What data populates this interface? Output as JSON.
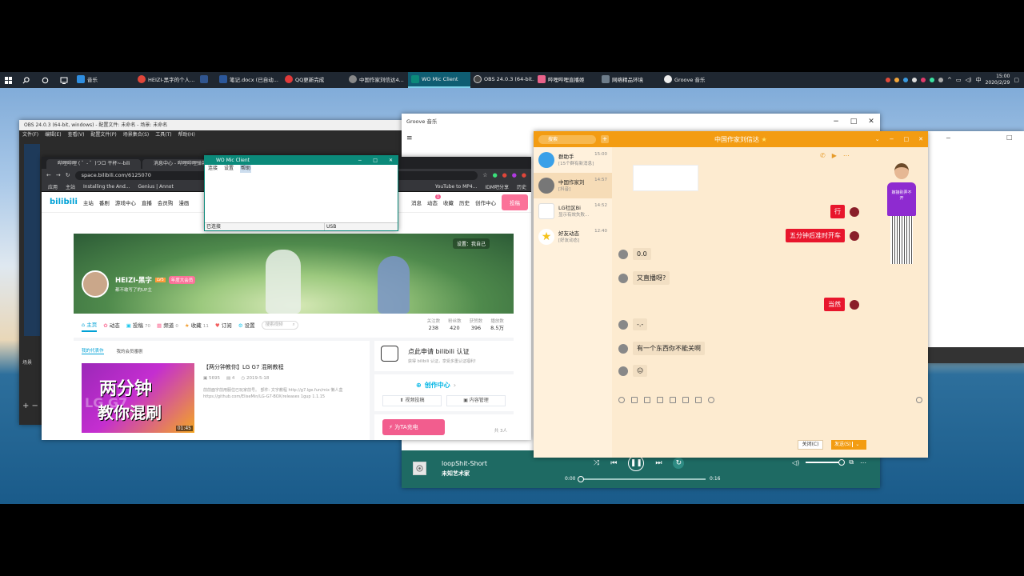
{
  "taskbar": {
    "apps": [
      {
        "label": "音乐",
        "color": "#2f8ee0"
      },
      {
        "label": "HEIZI-黑字的个人...",
        "color": "#e0463a"
      },
      {
        "label": "",
        "color": "#30558f"
      },
      {
        "label": "笔记.docx (已自动...",
        "color": "#2b579a"
      },
      {
        "label": "QQ更新完成",
        "color": "#e03a3a"
      },
      {
        "label": "中国作家刘信达4...",
        "color": "#888888"
      },
      {
        "label": "WO Mic Client",
        "color": "#0b8a7a"
      },
      {
        "label": "OBS 24.0.3 (64-bit...",
        "color": "#444444"
      },
      {
        "label": "哔哩哔哩直播姬",
        "color": "#e8628a"
      },
      {
        "label": "网络精品环境",
        "color": "#6d7c8a"
      },
      {
        "label": "Groove 音乐",
        "color": "#eeeeee"
      }
    ],
    "tray": {
      "lang": "中",
      "time": "15:00",
      "date": "2020/2/29"
    }
  },
  "obs": {
    "title": "OBS 24.0.3 (64-bit, windows) - 配置文件: 未命名 - 场景: 未命名",
    "menu": [
      "文件(F)",
      "编辑(E)",
      "查看(V)",
      "配置文件(P)",
      "场景集合(S)",
      "工具(T)",
      "帮助(H)"
    ],
    "scenes_label": "场景"
  },
  "groove": {
    "title": "Groove 音乐",
    "track": "loopShit-Short",
    "artist": "未知艺术家",
    "time_elapsed": "0:00",
    "time_total": "0:16",
    "progress": 0.0
  },
  "chrome": {
    "tabs": [
      "哔哩哔哩 ( ゜- ゜)つロ 干杯~-bili",
      "消息中心 - 哔哩哔哩弹幕..."
    ],
    "url": "space.bilibili.com/6125070",
    "bookmarks": [
      "应用",
      "主站",
      "Installing the And...",
      "Genius | Annot"
    ],
    "bookmarks_right": [
      "YouTube to MP4...",
      "IDM吧分享",
      "历史"
    ],
    "nav": {
      "logo": "bilibili",
      "items": [
        "主站",
        "番剧",
        "游戏中心",
        "直播",
        "会员购",
        "漫画"
      ],
      "right": [
        "消息",
        "动态",
        "收藏",
        "历史",
        "创作中心"
      ],
      "upload": "投稿",
      "msg_badge": "1"
    },
    "banner_btn": "设置：我自己",
    "profile": {
      "name": "HEIZI-黑字",
      "level": "LV5",
      "vip": "年度大会员",
      "sign": "都不敢写了的UP主"
    },
    "tabs_profile": [
      {
        "label": "主页",
        "count": ""
      },
      {
        "label": "动态",
        "count": ""
      },
      {
        "label": "投稿",
        "count": "70"
      },
      {
        "label": "频道",
        "count": "0"
      },
      {
        "label": "收藏",
        "count": "11"
      },
      {
        "label": "订阅",
        "count": ""
      },
      {
        "label": "设置",
        "count": ""
      }
    ],
    "search_placeholder": "搜索视频",
    "stats": [
      {
        "label": "关注数",
        "value": "238"
      },
      {
        "label": "粉丝数",
        "value": "420"
      },
      {
        "label": "获赞数",
        "value": "396"
      },
      {
        "label": "播放数",
        "value": "8.5万"
      }
    ],
    "section_tabs": [
      "我的代表作",
      "我的会员番剧"
    ],
    "video": {
      "thumb_line1": "两分钟",
      "thumb_line2": "教你混刷",
      "thumb_bg_text": "LG G7",
      "duration": "01:45",
      "title": "【两分钟教你】LG G7 混刷教程",
      "views": "5695",
      "danmaku": "4",
      "date": "2019-5-18",
      "desc": "前前面字前用服住已玩家前号。 部件: 文字教程 http://g7.lge.fun/mix 懒人盒 https://github.com/EliseMin/LG-G7-BOX/releases 1gup 1.1.15"
    },
    "auth": {
      "title": "点此申请 bilibili 认证",
      "sub": "获得 bilibili 认证，享受多重认证福利!"
    },
    "creator": {
      "title": "创作中心",
      "btn1": "视频投稿",
      "btn2": "内容管理"
    },
    "charge": {
      "label": "为TA充电",
      "count": "共 3人"
    }
  },
  "womic": {
    "title": "WO Mic Client",
    "menu": [
      "连接",
      "设置",
      "帮助"
    ],
    "status_left": "已连接",
    "status_right": "USB"
  },
  "qq": {
    "search": "搜索",
    "title": "中国作家刘信达",
    "contacts": [
      {
        "name": "群助手",
        "sub": "[15个群有新消息]",
        "time": "15:00",
        "color": "#3aa0e8"
      },
      {
        "name": "中国作家刘",
        "sub": "[抖音]",
        "time": "14:57",
        "color": "#777777"
      },
      {
        "name": "LG社区Bi",
        "sub": "显示有效失败...",
        "time": "14:52",
        "color": "#ffffff"
      },
      {
        "name": "好友动态",
        "sub": "[好友动态]",
        "time": "12:40",
        "color": "#f5c21b"
      }
    ],
    "messages": [
      {
        "side": "right",
        "text": "行"
      },
      {
        "side": "right",
        "text": "五分钟后准时开车"
      },
      {
        "side": "left",
        "text": "0.0"
      },
      {
        "side": "left",
        "text": "又直播呀?"
      },
      {
        "side": "right",
        "text": "当然"
      },
      {
        "side": "left",
        "text": "-.-"
      },
      {
        "side": "left",
        "text": "有一个东西你不能关啊"
      },
      {
        "side": "left",
        "text": "😑"
      }
    ],
    "close_btn": "关闭(C)",
    "send_btn": "发送(S)",
    "mascot_text": "嫁接别弄不开"
  }
}
